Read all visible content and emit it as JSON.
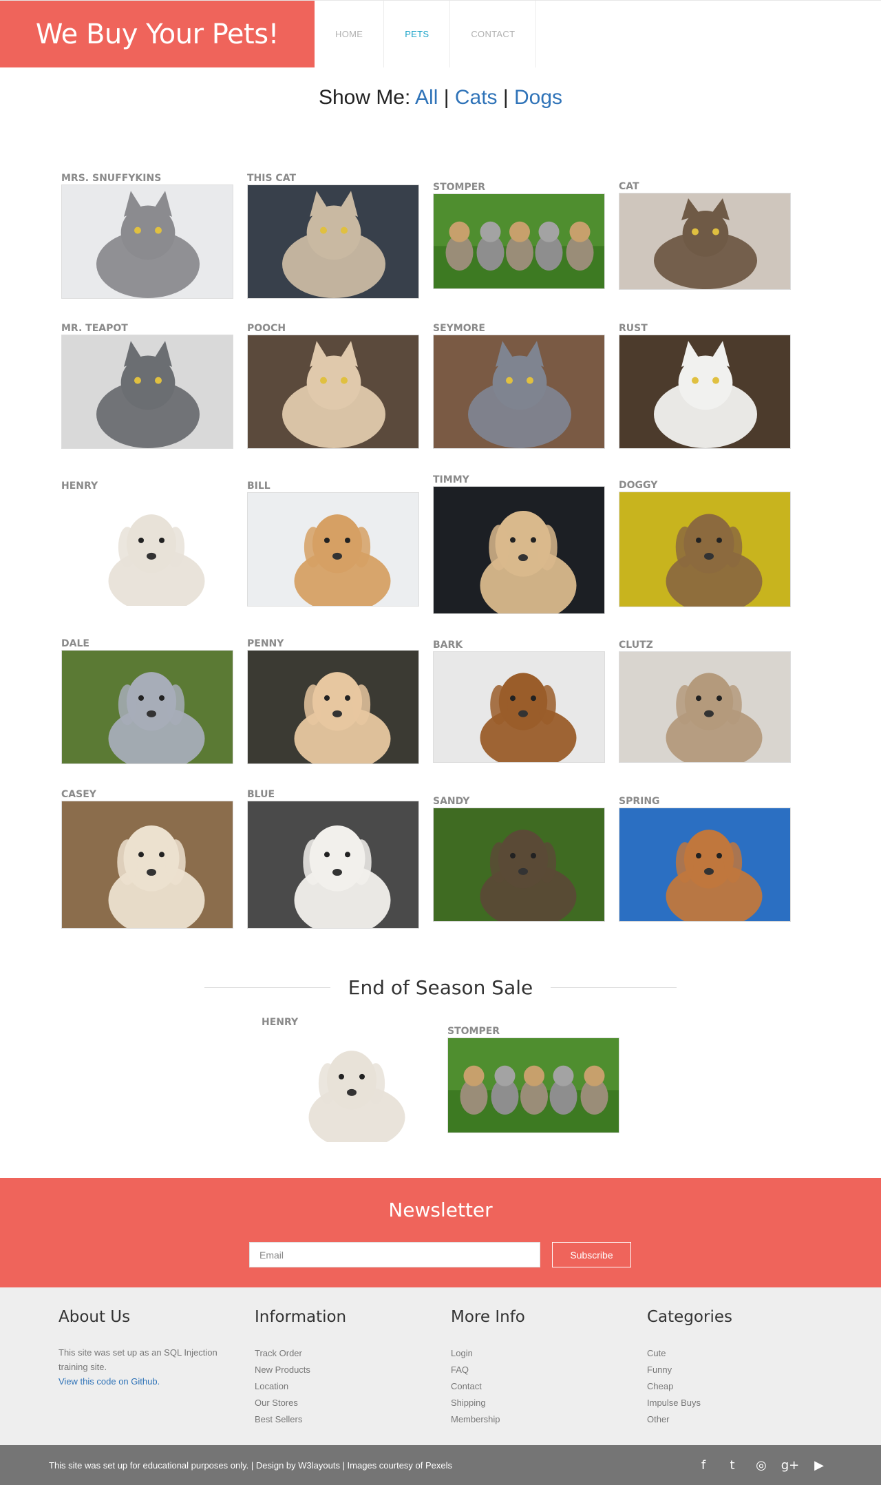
{
  "header": {
    "brand": "We Buy Your Pets!",
    "nav": [
      {
        "label": "HOME",
        "active": false
      },
      {
        "label": "PETS",
        "active": true
      },
      {
        "label": "CONTACT",
        "active": false
      }
    ]
  },
  "filter": {
    "prefix": "Show Me:",
    "all": "All",
    "cats": "Cats",
    "dogs": "Dogs",
    "separator": "|"
  },
  "pets": [
    {
      "name": "MRS. SNUFFYKINS",
      "bg": "#e9eaec",
      "subject": "#8b8b8f",
      "scene": "cat"
    },
    {
      "name": "THIS CAT",
      "bg": "#38404b",
      "subject": "#c9b9a2",
      "scene": "cat"
    },
    {
      "name": "STOMPER",
      "bg": "#4f8e2f",
      "subject": "#9a8d78",
      "scene": "kittens"
    },
    {
      "name": "CAT",
      "bg": "#cfc6bd",
      "subject": "#6f5a46",
      "scene": "cat"
    },
    {
      "name": "MR. TEAPOT",
      "bg": "#d9d9d9",
      "subject": "#6b6e72",
      "scene": "cat"
    },
    {
      "name": "POOCH",
      "bg": "#5b4a3c",
      "subject": "#e0c9ac",
      "scene": "cat"
    },
    {
      "name": "SEYMORE",
      "bg": "#7a5a44",
      "subject": "#7f8490",
      "scene": "cat"
    },
    {
      "name": "RUST",
      "bg": "#4c3b2c",
      "subject": "#f1f1ef",
      "scene": "cat"
    },
    {
      "name": "HENRY",
      "bg": "#ffffff",
      "subject": "#e8e2d8",
      "scene": "dog"
    },
    {
      "name": "BILL",
      "bg": "#eceef0",
      "subject": "#d6a064",
      "scene": "dog"
    },
    {
      "name": "TIMMY",
      "bg": "#1c1f24",
      "subject": "#d9b98c",
      "scene": "dog"
    },
    {
      "name": "DOGGY",
      "bg": "#c8b41e",
      "subject": "#8c6a3e",
      "scene": "dog"
    },
    {
      "name": "DALE",
      "bg": "#5b7a34",
      "subject": "#a7adb8",
      "scene": "dog"
    },
    {
      "name": "PENNY",
      "bg": "#3b3a33",
      "subject": "#e7c7a0",
      "scene": "dog"
    },
    {
      "name": "BARK",
      "bg": "#e8e8e8",
      "subject": "#9a5d2a",
      "scene": "dog"
    },
    {
      "name": "CLUTZ",
      "bg": "#d9d5cf",
      "subject": "#b49a7c",
      "scene": "dog"
    },
    {
      "name": "CASEY",
      "bg": "#8b6d4c",
      "subject": "#ece1cf",
      "scene": "dog"
    },
    {
      "name": "BLUE",
      "bg": "#4a4a4a",
      "subject": "#f2f0ec",
      "scene": "dog"
    },
    {
      "name": "SANDY",
      "bg": "#3f6b22",
      "subject": "#5a4a36",
      "scene": "dog"
    },
    {
      "name": "SPRING",
      "bg": "#2b6fc2",
      "subject": "#c0773d",
      "scene": "dog"
    }
  ],
  "sale": {
    "title": "End of Season Sale",
    "pets": [
      {
        "name": "HENRY",
        "bg": "#ffffff",
        "subject": "#e8e2d8",
        "scene": "dog"
      },
      {
        "name": "STOMPER",
        "bg": "#4f8e2f",
        "subject": "#9a8d78",
        "scene": "kittens"
      }
    ]
  },
  "newsletter": {
    "title": "Newsletter",
    "email_placeholder": "Email",
    "subscribe_label": "Subscribe"
  },
  "footer": {
    "about": {
      "title": "About Us",
      "text": "This site was set up as an SQL Injection training site.",
      "link": "View this code on Github."
    },
    "information": {
      "title": "Information",
      "items": [
        "Track Order",
        "New Products",
        "Location",
        "Our Stores",
        "Best Sellers"
      ]
    },
    "more_info": {
      "title": "More Info",
      "items": [
        "Login",
        "FAQ",
        "Contact",
        "Shipping",
        "Membership"
      ]
    },
    "categories": {
      "title": "Categories",
      "items": [
        "Cute",
        "Funny",
        "Cheap",
        "Impulse Buys",
        "Other"
      ]
    }
  },
  "bottom": {
    "copyright": "This site was set up for educational purposes only. | Design by W3layouts | Images courtesy of Pexels",
    "social": [
      {
        "icon": "facebook-icon",
        "glyph": "f"
      },
      {
        "icon": "twitter-icon",
        "glyph": "t"
      },
      {
        "icon": "dribbble-icon",
        "glyph": "◎"
      },
      {
        "icon": "google-plus-icon",
        "glyph": "g+"
      },
      {
        "icon": "youtube-icon",
        "glyph": "▶"
      }
    ]
  },
  "colors": {
    "accent": "#ef645b",
    "link": "#2f73b8",
    "nav_active": "#1aa3c8"
  }
}
